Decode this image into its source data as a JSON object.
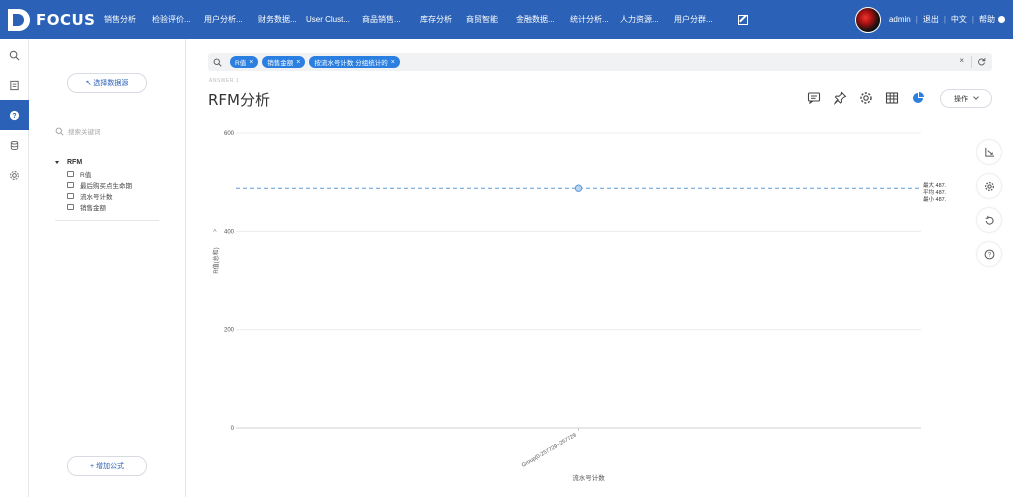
{
  "brand": {
    "name": "FOCUS"
  },
  "nav": {
    "items": [
      "销售分析",
      "检验评价...",
      "用户分析...",
      "财务数据...",
      "User Clust...",
      "商品销售...",
      "库存分析",
      "商贸智能",
      "金融数据...",
      "统计分析...",
      "人力资源...",
      "用户分群..."
    ],
    "edit_icon": "edit-icon"
  },
  "user": {
    "name": "admin",
    "logout": "退出",
    "lang": "中文",
    "help": "帮助"
  },
  "rail": {
    "icons": [
      "search-icon",
      "bookmark-icon",
      "question-icon",
      "database-icon",
      "gear-icon"
    ],
    "active_index": 2
  },
  "left_panel": {
    "select_datasource": "↖ 选择数据源",
    "search_placeholder": "搜索关键词",
    "tree_root": "RFM",
    "tree_items": [
      "R值",
      "最后购买点生命期",
      "流水号计数",
      "销售金额"
    ],
    "add_formula": "+ 增加公式"
  },
  "filter": {
    "chips": [
      "R值",
      "销售金额",
      "按流水号计数 分组统计的"
    ],
    "clear": "×"
  },
  "answer_tag": "ANSWER 1",
  "page_title": "RFM分析",
  "toolbar": {
    "icons": [
      "comment-icon",
      "pin-icon",
      "settings-icon",
      "table-icon",
      "pie-chart-icon"
    ],
    "operate": "操作"
  },
  "side_tools": [
    "axis-icon",
    "gear-icon",
    "refresh-icon",
    "help-icon"
  ],
  "chart_data": {
    "type": "line",
    "categories": [
      "Group(0-257729~257729"
    ],
    "series": [
      {
        "values": [
          487.68
        ]
      }
    ],
    "ylim": [
      0,
      600
    ],
    "yticks": [
      0,
      200,
      400,
      600
    ],
    "xlabel": "流水号计数",
    "ylabel": "R值(总和)",
    "annotations": {
      "max": "最大 487.68",
      "avg": "平均 487.68",
      "min": "最小 487.68"
    },
    "grid": true,
    "accent": "#5b9bd5"
  }
}
